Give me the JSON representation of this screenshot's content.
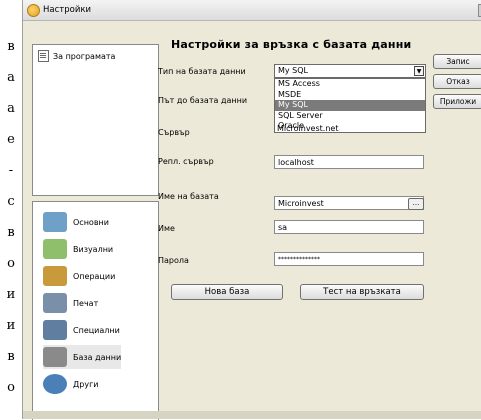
{
  "left_glyphs": [
    "в",
    "а",
    "а",
    "е",
    "-",
    "с",
    "в",
    "о",
    "и",
    "и",
    "в",
    "о"
  ],
  "window": {
    "title": "Настройки"
  },
  "tree": {
    "items": [
      {
        "label": "За програмата"
      }
    ]
  },
  "categories": [
    {
      "label": "Основни",
      "icon": "general-settings-icon",
      "color": "#6fa0c8"
    },
    {
      "label": "Визуални",
      "icon": "visual-settings-icon",
      "color": "#8fbf6a"
    },
    {
      "label": "Операции",
      "icon": "operations-icon",
      "color": "#c89a3c"
    },
    {
      "label": "Печат",
      "icon": "printer-icon",
      "color": "#7a8fa8"
    },
    {
      "label": "Специални",
      "icon": "special-settings-icon",
      "color": "#5f7ea0"
    },
    {
      "label": "База данни",
      "icon": "database-icon",
      "color": "#8a8a8a"
    },
    {
      "label": "Други",
      "icon": "other-settings-icon",
      "color": "#4a7fb8"
    }
  ],
  "form": {
    "heading": "Настройки за връзка с базата данни",
    "db_type": {
      "label": "Тип на базата данни",
      "value": "My SQL",
      "options": [
        "MS Access",
        "MSDE",
        "My SQL",
        "SQL Server",
        "Oracle"
      ],
      "selected_index": 2
    },
    "db_path": {
      "label": "Път до базата данни"
    },
    "server": {
      "label": "Сървър",
      "value": "Microinvest.net"
    },
    "repl_server": {
      "label": "Репл. сървър",
      "value": "localhost"
    },
    "db_name": {
      "label": "Име на базата",
      "value": "Microinvest",
      "browse": "..."
    },
    "username": {
      "label": "Име",
      "value": "sa"
    },
    "password": {
      "label": "Парола",
      "value": "**************"
    },
    "new_db_button": "Нова база",
    "test_button": "Тест на връзката"
  },
  "side_buttons": {
    "save": "Запис",
    "cancel": "Отказ",
    "apply": "Приложи"
  }
}
